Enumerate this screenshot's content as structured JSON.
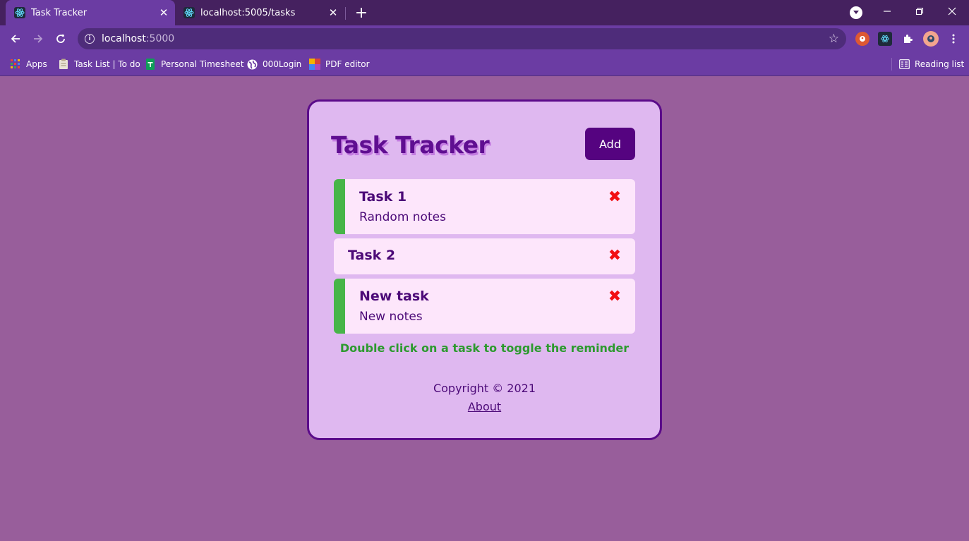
{
  "browser": {
    "tabs": [
      {
        "title": "Task Tracker",
        "active": true,
        "icon": "react-icon"
      },
      {
        "title": "localhost:5005/tasks",
        "active": false,
        "icon": "react-icon"
      }
    ],
    "address": {
      "host": "localhost",
      "port": ":5000"
    },
    "bookmarks": [
      {
        "label": "Apps",
        "icon": "apps-grid-icon"
      },
      {
        "label": "Task List | To do",
        "icon": "clipboard-icon"
      },
      {
        "label": "Personal Timesheet",
        "icon": "sheets-icon"
      },
      {
        "label": "000Login",
        "icon": "globe-icon"
      },
      {
        "label": "PDF editor",
        "icon": "pdf-editor-icon"
      }
    ],
    "reading_list": "Reading list"
  },
  "app": {
    "title": "Task Tracker",
    "add_label": "Add",
    "tasks": [
      {
        "title": "Task 1",
        "notes": "Random notes",
        "reminder": true
      },
      {
        "title": "Task 2",
        "notes": "",
        "reminder": false
      },
      {
        "title": "New task",
        "notes": "New notes",
        "reminder": true
      }
    ],
    "hint": "Double click on a task to toggle the reminder",
    "copyright": "Copyright © 2021",
    "about": "About"
  },
  "colors": {
    "page_bg": "#985e9b",
    "card_bg": "#dfb8f0",
    "accent": "#550380",
    "reminder": "#47b548",
    "delete": "#f20f12"
  }
}
